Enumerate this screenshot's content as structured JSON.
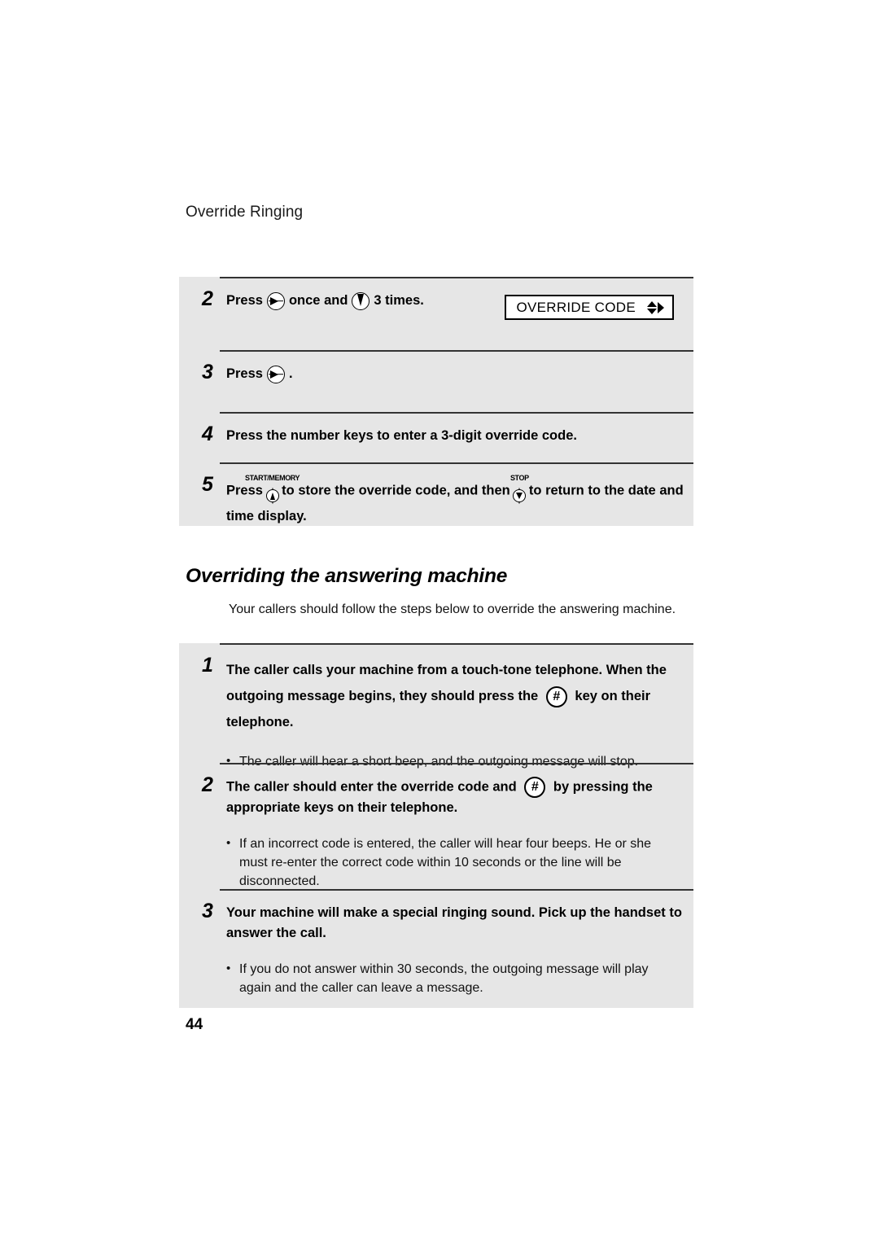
{
  "page": {
    "running_header": "Override Ringing",
    "page_number": "44"
  },
  "panel_top": {
    "steps": [
      {
        "number": "2",
        "text_before_key1": "Press",
        "key1_icon": "right-arrow-key-icon",
        "text_between": "once and",
        "key2_icon": "down-wedge-key-icon",
        "text_after": "3 times.",
        "display": {
          "text": "OVERRIDE CODE",
          "arrows_icon": "up-down-right-arrows-icon"
        }
      },
      {
        "number": "3",
        "text_before_key1": "Press",
        "key1_icon": "right-arrow-key-icon",
        "text_after": "."
      },
      {
        "number": "4",
        "text": "Press the number keys to enter a 3-digit override code."
      },
      {
        "number": "5",
        "text_before_key1": "Press",
        "key1_label": "START/MEMORY",
        "key1_icon": "start-memory-button-icon",
        "text_between": "to store the override code, and then",
        "key2_label": "STOP",
        "key2_icon": "stop-button-icon",
        "text_after": "to return to the date and time display."
      }
    ]
  },
  "section": {
    "heading": "Overriding the answering machine",
    "intro": "Your callers should follow the steps below to override the answering machine."
  },
  "panel_bottom": {
    "steps": [
      {
        "number": "1",
        "text_part1": "The caller calls your machine from a touch-tone telephone. When the outgoing message begins, they should press the",
        "key_icon": "hash-key-icon",
        "key_glyph": "#",
        "text_part2": "key on their telephone.",
        "bullets": [
          {
            "marker": "•",
            "text": "The caller will hear a short beep, and the outgoing message will stop."
          }
        ]
      },
      {
        "number": "2",
        "text_part1": "The caller should enter the override code and",
        "key_icon": "hash-key-icon",
        "key_glyph": "#",
        "text_part2": "by pressing the appropriate keys on their telephone.",
        "bullets": [
          {
            "marker": "•",
            "text": "If an incorrect code is entered, the caller will hear four beeps. He or she must re-enter the correct code within 10 seconds or the line will be disconnected."
          }
        ]
      },
      {
        "number": "3",
        "text_part1": "Your machine will make a special ringing sound. Pick up the handset to answer the call.",
        "bullets": [
          {
            "marker": "•",
            "text": "If you do not answer within 30 seconds, the outgoing message will play again and the caller can leave a message."
          }
        ]
      }
    ]
  },
  "colors": {
    "panel_background": "#e6e6e6",
    "rule": "#333333",
    "page_background": "#ffffff",
    "text": "#000000"
  }
}
